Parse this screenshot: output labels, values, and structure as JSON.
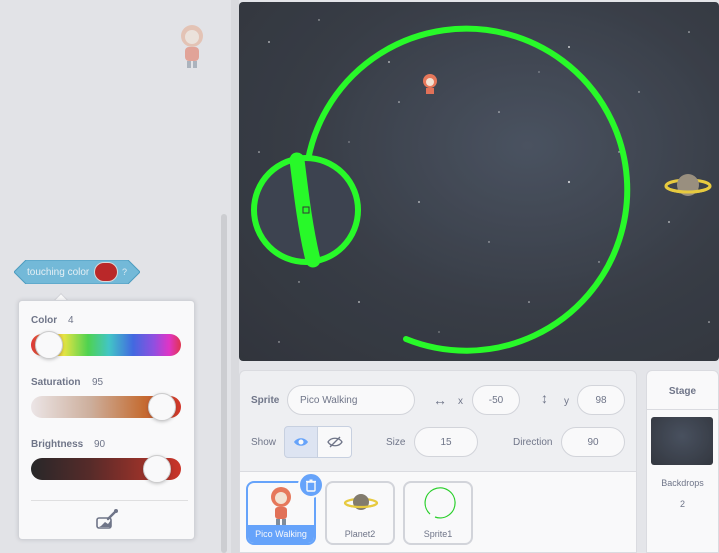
{
  "touching_block": {
    "label": "touching color",
    "swatch_color": "#b20000",
    "help": "?"
  },
  "color_picker": {
    "color": {
      "label": "Color",
      "value": 4
    },
    "saturation": {
      "label": "Saturation",
      "value": 95
    },
    "brightness": {
      "label": "Brightness",
      "value": 90
    },
    "eyedropper_icon": "eyedropper-icon"
  },
  "stage": {
    "sprites_visible": [
      "pico-walking",
      "planet2",
      "sprite1-ring"
    ],
    "magnifier_visible": true
  },
  "sprite_info": {
    "sprite_label": "Sprite",
    "sprite_name": "Pico Walking",
    "x_label": "x",
    "x_value": "-50",
    "y_label": "y",
    "y_value": "98",
    "show_label": "Show",
    "size_label": "Size",
    "size_value": "15",
    "direction_label": "Direction",
    "direction_value": "90"
  },
  "sprites": [
    {
      "name": "Pico Walking",
      "selected": true
    },
    {
      "name": "Planet2",
      "selected": false
    },
    {
      "name": "Sprite1",
      "selected": false
    }
  ],
  "stage_pane": {
    "title": "Stage",
    "backdrops_label": "Backdrops",
    "backdrops_count": "2"
  },
  "colors": {
    "accent": "#4c97ff",
    "ring": "#00ff00",
    "block": "#5cb1d6"
  }
}
